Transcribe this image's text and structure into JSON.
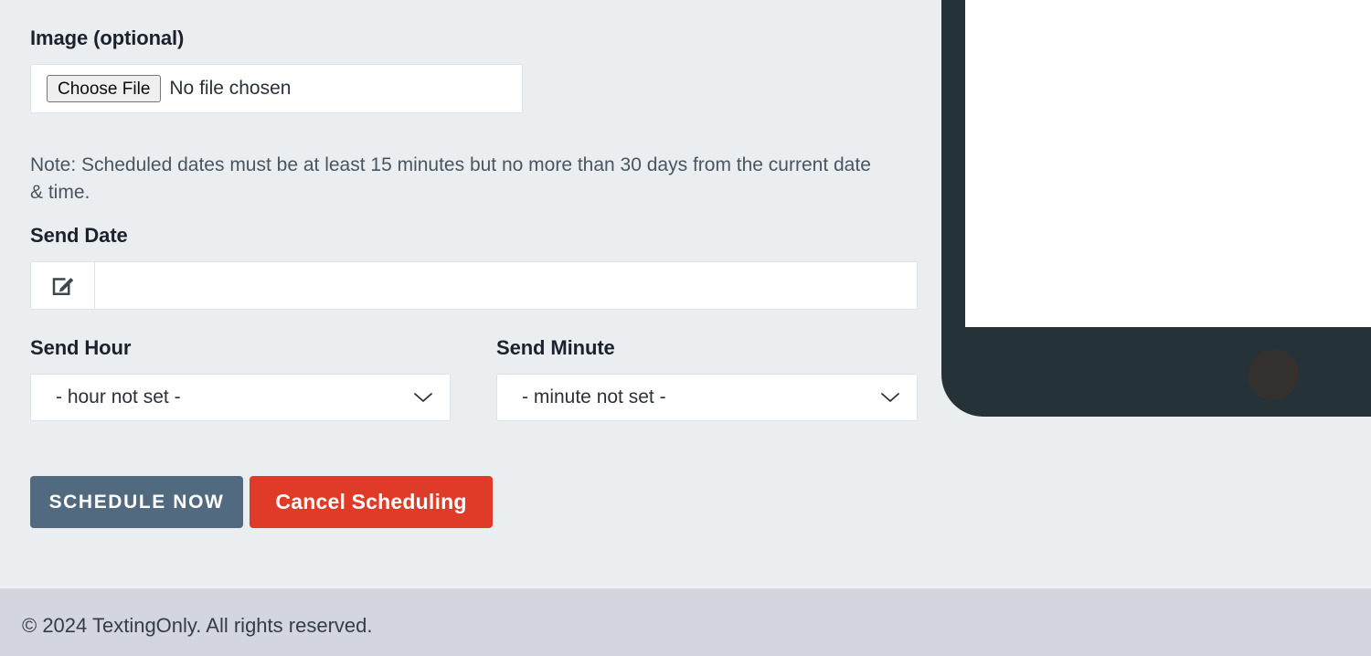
{
  "form": {
    "image_label": "Image (optional)",
    "file_input": {
      "button_label": "Choose File",
      "status_text": "No file chosen"
    },
    "note": "Note: Scheduled dates must be at least 15 minutes but no more than 30 days from the current date & time.",
    "send_date": {
      "label": "Send Date",
      "value": "",
      "placeholder": "",
      "icon": "edit-pencil-square-icon"
    },
    "send_hour": {
      "label": "Send Hour",
      "selected": "- hour not set -",
      "chevron": "chevron-down-icon"
    },
    "send_minute": {
      "label": "Send Minute",
      "selected": "- minute not set -",
      "chevron": "chevron-down-icon"
    },
    "actions": {
      "primary_label": "SCHEDULE NOW",
      "danger_label": "Cancel Scheduling"
    }
  },
  "device": {
    "type": "tablet-mockup",
    "screen_content": ""
  },
  "footer": {
    "copyright": "© 2024 TextingOnly. All rights reserved."
  },
  "colors": {
    "page_background": "#eaeef1",
    "footer_background": "#d3d6de",
    "primary_button": "#516a80",
    "danger_button": "#e03a28",
    "device_bezel": "#253238",
    "label_text": "#1b222b",
    "body_text": "#4a5560"
  }
}
